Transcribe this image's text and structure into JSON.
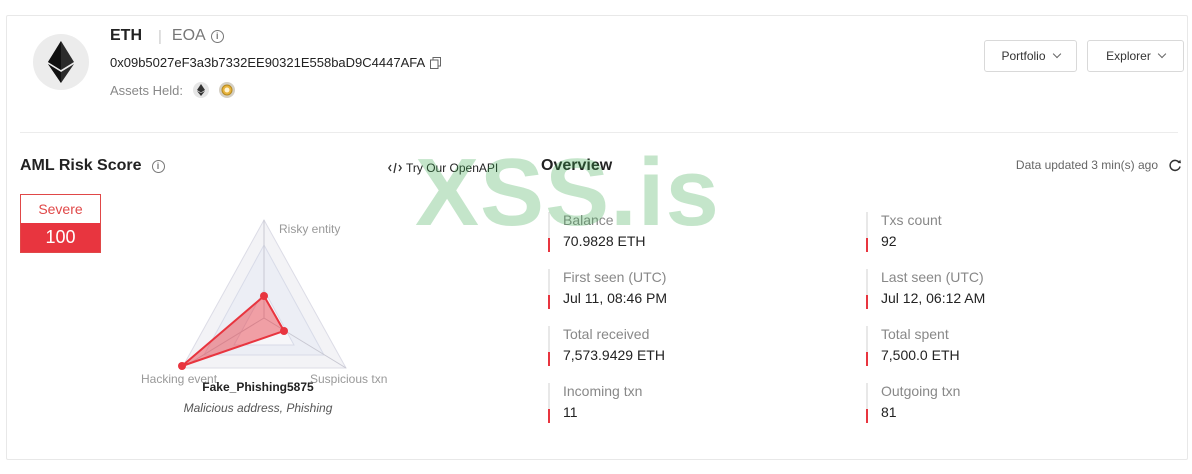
{
  "header": {
    "title": "ETH",
    "account_type": "EOA",
    "address": "0x09b5027eF3a3b7332EE90321E558baD9C4447AFA",
    "assets_label": "Assets Held:",
    "assets": [
      "eth-icon",
      "coin-icon"
    ]
  },
  "buttons": {
    "portfolio": "Portfolio",
    "explorer": "Explorer"
  },
  "aml": {
    "title": "AML Risk Score",
    "openapi_label": "Try Our OpenAPI",
    "risk_level": "Severe",
    "risk_score": "100",
    "radar": {
      "axes": [
        "Risky entity",
        "Suspicious txn",
        "Hacking event"
      ]
    },
    "entity_name": "Fake_Phishing5875",
    "entity_tags": "Malicious address, Phishing"
  },
  "overview": {
    "title": "Overview",
    "updated": "Data updated 3 min(s) ago",
    "stats": [
      {
        "label": "Balance",
        "value": "70.9828 ETH"
      },
      {
        "label": "Txs count",
        "value": "92"
      },
      {
        "label": "First seen (UTC)",
        "value": "Jul 11, 08:46 PM"
      },
      {
        "label": "Last seen (UTC)",
        "value": "Jul 12, 06:12 AM"
      },
      {
        "label": "Total received",
        "value": "7,573.9429 ETH"
      },
      {
        "label": "Total spent",
        "value": "7,500.0 ETH"
      },
      {
        "label": "Incoming txn",
        "value": "11"
      },
      {
        "label": "Outgoing txn",
        "value": "81"
      }
    ]
  },
  "watermark": "XSS.is",
  "colors": {
    "accent_red": "#e8353f",
    "border": "#e8e8e8",
    "watermark_green": "#3caa50"
  }
}
